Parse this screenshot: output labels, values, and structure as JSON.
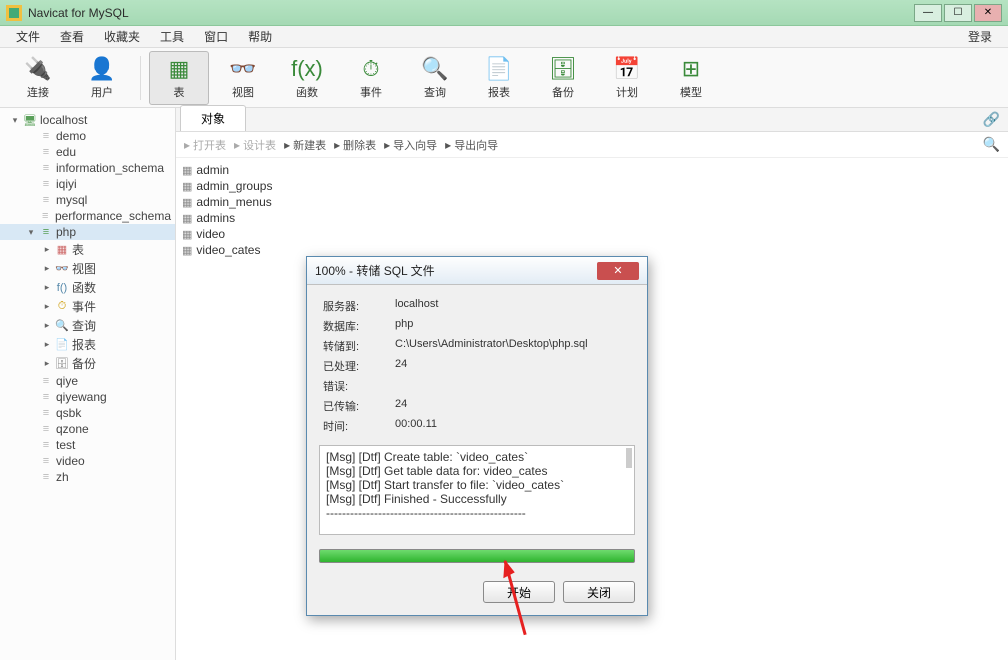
{
  "window": {
    "title": "Navicat for MySQL"
  },
  "menubar": {
    "items": [
      "文件",
      "查看",
      "收藏夹",
      "工具",
      "窗口",
      "帮助"
    ],
    "login": "登录"
  },
  "toolbar": {
    "items": [
      {
        "label": "连接",
        "glyph": "🔌"
      },
      {
        "label": "用户",
        "glyph": "👤"
      },
      {
        "label": "表",
        "glyph": "▦",
        "active": true
      },
      {
        "label": "视图",
        "glyph": "👓"
      },
      {
        "label": "函数",
        "glyph": "f(x)"
      },
      {
        "label": "事件",
        "glyph": "⏱"
      },
      {
        "label": "查询",
        "glyph": "🔍"
      },
      {
        "label": "报表",
        "glyph": "📄"
      },
      {
        "label": "备份",
        "glyph": "🗄"
      },
      {
        "label": "计划",
        "glyph": "📅"
      },
      {
        "label": "模型",
        "glyph": "⊞"
      }
    ]
  },
  "sidebar": {
    "connection": "localhost",
    "databases_before": [
      "demo",
      "edu",
      "information_schema",
      "iqiyi",
      "mysql",
      "performance_schema"
    ],
    "active_db": "php",
    "active_children": [
      {
        "label": "表",
        "glyph": "▦",
        "color": "#c66"
      },
      {
        "label": "视图",
        "glyph": "👓",
        "color": "#666"
      },
      {
        "label": "函数",
        "glyph": "f()",
        "color": "#58a"
      },
      {
        "label": "事件",
        "glyph": "⏱",
        "color": "#c90"
      },
      {
        "label": "查询",
        "glyph": "🔍",
        "color": "#3a8"
      },
      {
        "label": "报表",
        "glyph": "📄",
        "color": "#888"
      },
      {
        "label": "备份",
        "glyph": "🗄",
        "color": "#888"
      }
    ],
    "databases_after": [
      "qiye",
      "qiyewang",
      "qsbk",
      "qzone",
      "test",
      "video",
      "zh"
    ]
  },
  "tabs": {
    "active": "对象"
  },
  "actionbar": {
    "items": [
      {
        "label": "打开表",
        "enabled": false
      },
      {
        "label": "设计表",
        "enabled": false
      },
      {
        "label": "新建表",
        "enabled": true
      },
      {
        "label": "删除表",
        "enabled": true
      },
      {
        "label": "导入向导",
        "enabled": true
      },
      {
        "label": "导出向导",
        "enabled": true
      }
    ]
  },
  "objects": [
    "admin",
    "admin_groups",
    "admin_menus",
    "admins",
    "video",
    "video_cates"
  ],
  "dialog": {
    "title": "100% - 转储 SQL 文件",
    "fields": {
      "server_k": "服务器:",
      "server_v": "localhost",
      "db_k": "数据库:",
      "db_v": "php",
      "path_k": "转储到:",
      "path_v": "C:\\Users\\Administrator\\Desktop\\php.sql",
      "proc_k": "已处理:",
      "proc_v": "24",
      "err_k": "错误:",
      "xfer_k": "已传输:",
      "xfer_v": "24",
      "time_k": "时间:",
      "time_v": "00:00.11"
    },
    "log": [
      "[Msg] [Dtf] Create table: `video_cates`",
      "[Msg] [Dtf] Get table data for: video_cates",
      "[Msg] [Dtf] Start transfer to file: `video_cates`",
      "[Msg] [Dtf] Finished - Successfully",
      "--------------------------------------------------"
    ],
    "buttons": {
      "start": "开始",
      "close": "关闭"
    }
  }
}
